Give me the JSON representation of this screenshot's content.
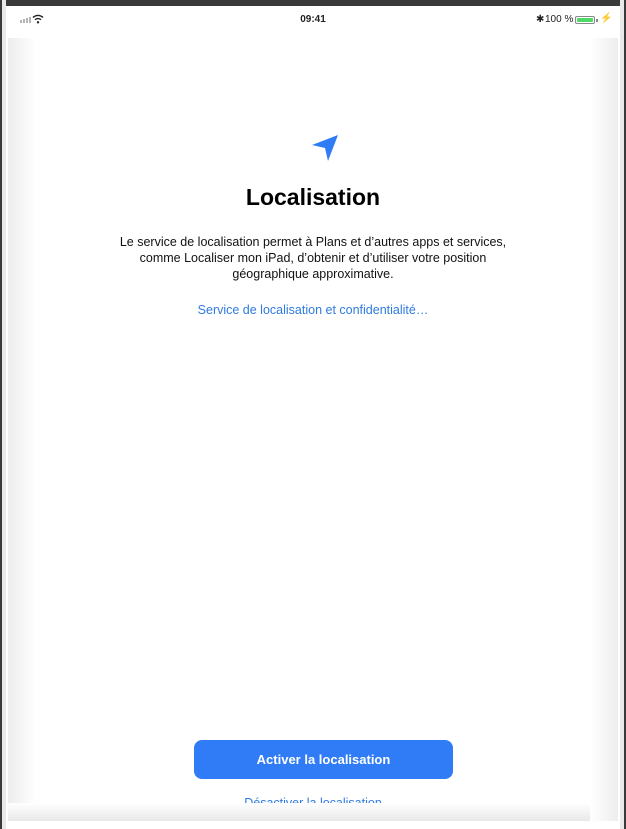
{
  "status_bar": {
    "time": "09:41",
    "battery_text": "100 %",
    "battery_level": 1.0,
    "battery_color": "#4cd964",
    "bluetooth_glyph": "✱",
    "charging_glyph": "⚡",
    "icons": [
      "signal-icon",
      "wifi-icon",
      "bluetooth-icon",
      "battery-icon",
      "charging-icon"
    ]
  },
  "main": {
    "icon": "location-arrow-icon",
    "accent_color": "#2f7cf6",
    "title": "Localisation",
    "description_lines": [
      "Le service de localisation permet à Plans et d’autres apps et services,",
      "comme Localiser mon iPad, d’obtenir et d’utiliser votre position",
      "géographique approximative."
    ],
    "privacy_link": "Service de localisation et confidentialité…"
  },
  "actions": {
    "enable_label": "Activer la localisation",
    "disable_label": "Désactiver la localisation"
  }
}
